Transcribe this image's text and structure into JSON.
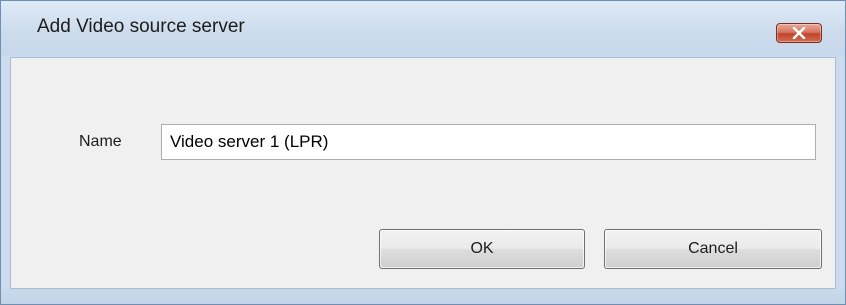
{
  "window": {
    "title": "Add Video source server",
    "close_icon": "close-icon"
  },
  "form": {
    "name_label": "Name",
    "name_value": "Video server 1 (LPR)"
  },
  "buttons": {
    "ok_label": "OK",
    "cancel_label": "Cancel"
  },
  "colors": {
    "title_bar": "#cddced",
    "close_button": "#c2442c",
    "client_area": "#f0f0f0"
  }
}
